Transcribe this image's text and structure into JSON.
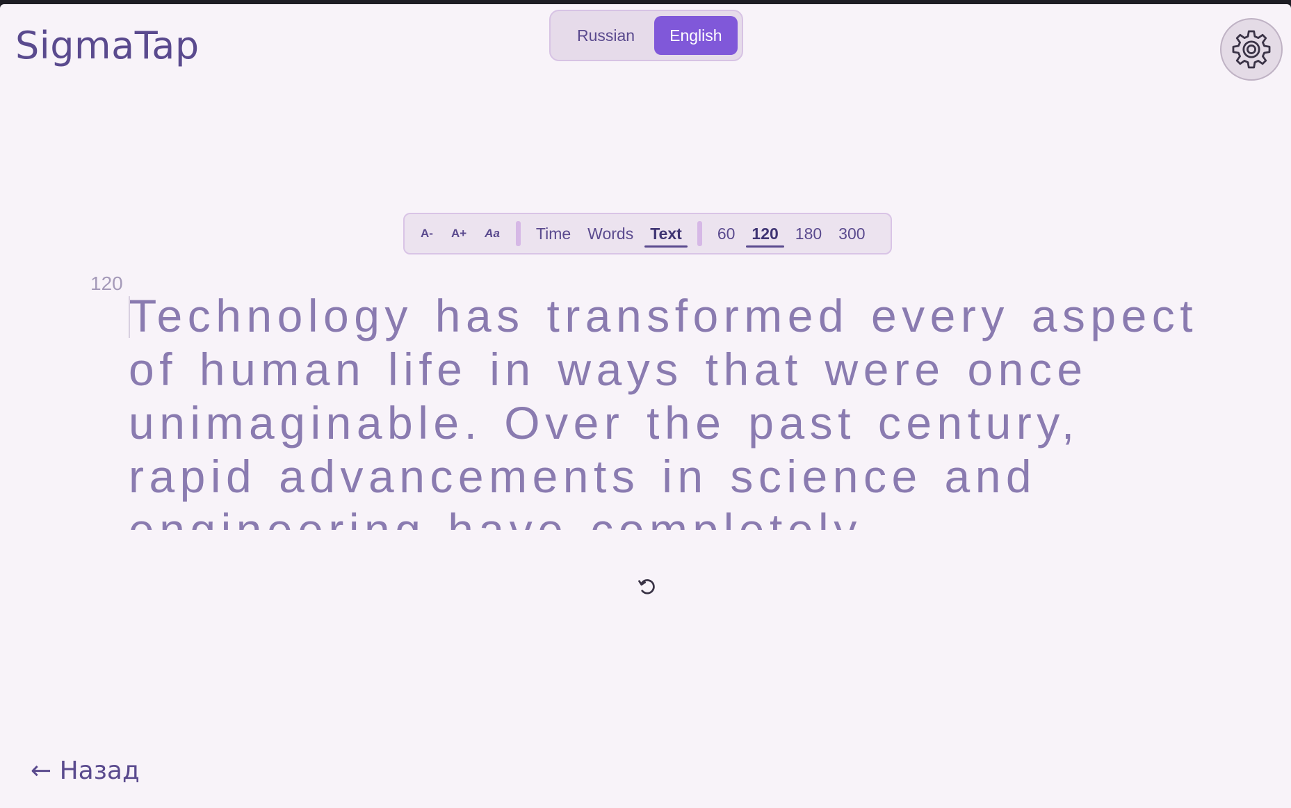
{
  "app": {
    "title": "SigmaTap"
  },
  "language": {
    "options": [
      {
        "label": "Russian",
        "selected": false
      },
      {
        "label": "English",
        "selected": true
      }
    ]
  },
  "settings": {
    "icon": "gear-icon"
  },
  "toolbar": {
    "font_controls": [
      {
        "label": "A-"
      },
      {
        "label": "A+"
      },
      {
        "label": "Aa"
      }
    ],
    "modes": [
      {
        "label": "Time",
        "selected": false
      },
      {
        "label": "Words",
        "selected": false
      },
      {
        "label": "Text",
        "selected": true
      }
    ],
    "counts": [
      {
        "label": "60",
        "selected": false
      },
      {
        "label": "120",
        "selected": true
      },
      {
        "label": "180",
        "selected": false
      },
      {
        "label": "300",
        "selected": false
      }
    ]
  },
  "test": {
    "counter": "120",
    "text": "Technology has transformed every aspect of human life in ways that were once unimaginable. Over the past century, rapid advancements in science and engineering have completely"
  },
  "restart": {
    "icon": "restart-icon"
  },
  "back": {
    "label": "← Назад"
  },
  "colors": {
    "accent": "#8058d9",
    "brand": "#5a4a8e",
    "background": "#f8f3f9",
    "text_pending": "#8a7bb0"
  }
}
